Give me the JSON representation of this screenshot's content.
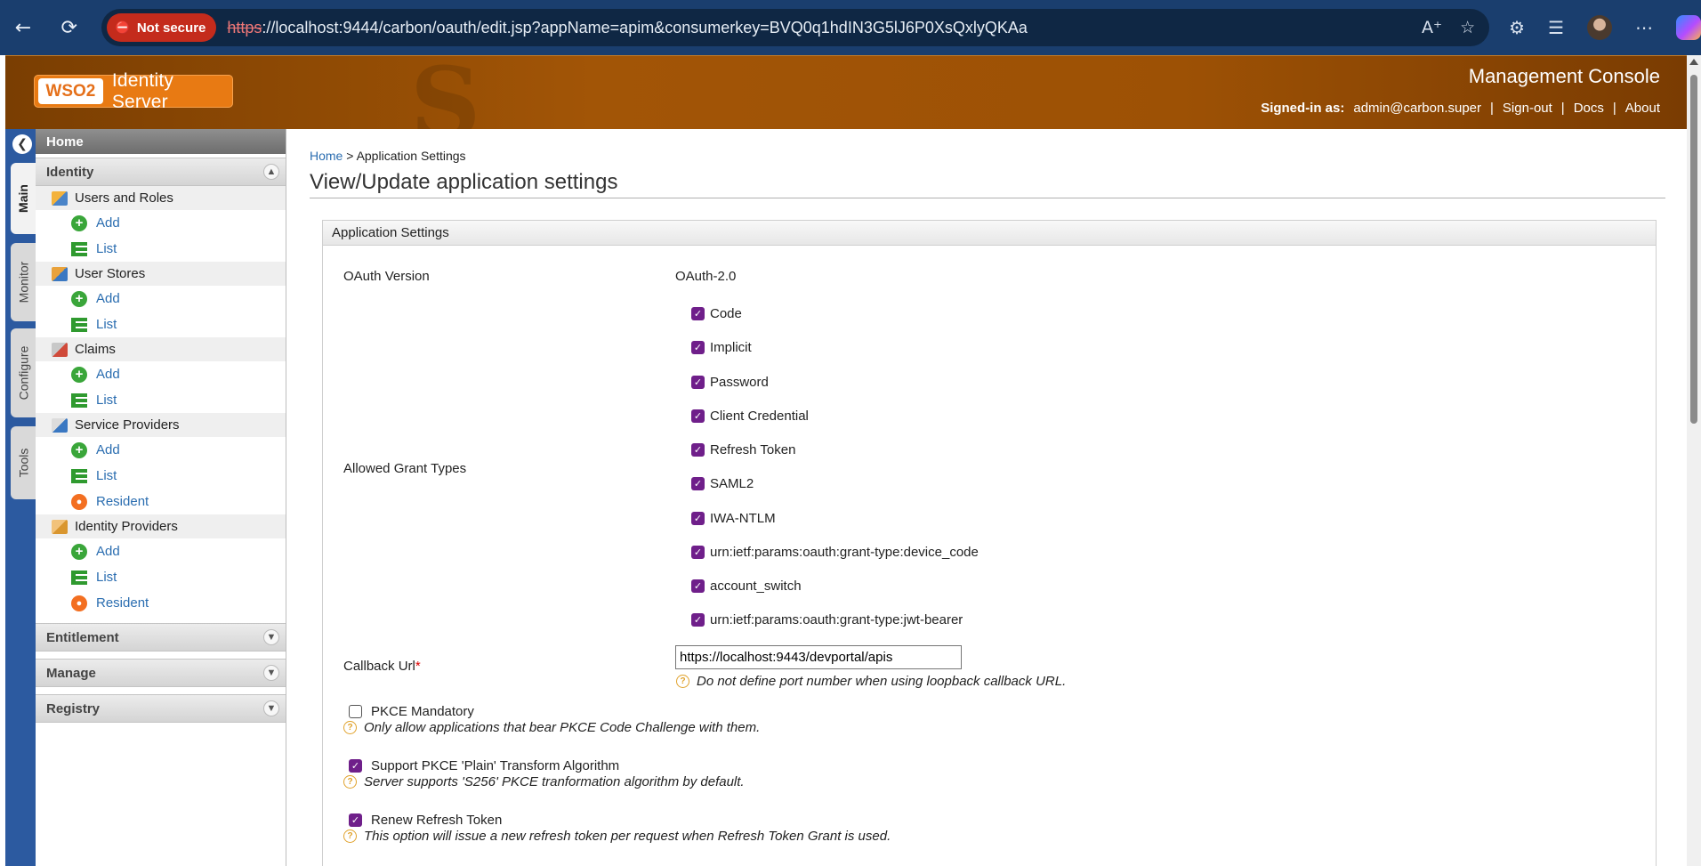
{
  "browser": {
    "not_secure": "Not secure",
    "url_proto": "https",
    "url_rest": "://localhost:9444/carbon/oauth/edit.jsp?appName=apim&consumerkey=BVQ0q1hdIN3G5lJ6P0XsQxlyQKAa",
    "icons": [
      "back-icon",
      "reload-icon",
      "read-aloud-icon",
      "favorite-icon",
      "extensions-icon",
      "favorites-list-icon",
      "profile-avatar",
      "more-icon",
      "copilot-icon"
    ]
  },
  "header": {
    "logo_brand": "WSO2",
    "logo_product": "Identity Server",
    "console_title": "Management Console",
    "signed_in_label": "Signed-in as:",
    "signed_in_user": "admin@carbon.super",
    "signout": "Sign-out",
    "docs": "Docs",
    "about": "About",
    "accent": "#a25506"
  },
  "vtabs": {
    "main": "Main",
    "monitor": "Monitor",
    "configure": "Configure",
    "tools": "Tools"
  },
  "menu": {
    "home": "Home",
    "identity": "Identity",
    "users_roles": "Users and Roles",
    "user_stores": "User Stores",
    "claims": "Claims",
    "service_providers": "Service Providers",
    "identity_providers": "Identity Providers",
    "add": "Add",
    "list": "List",
    "resident": "Resident",
    "entitlement": "Entitlement",
    "manage": "Manage",
    "registry": "Registry"
  },
  "content": {
    "breadcrumb_home": "Home",
    "breadcrumb_sep": ">",
    "breadcrumb_current": "Application Settings",
    "page_title": "View/Update application settings",
    "panel_title": "Application Settings",
    "oauth_version_label": "OAuth Version",
    "oauth_version_value": "OAuth-2.0",
    "grant_types_label": "Allowed Grant Types",
    "grant_types": [
      "Code",
      "Implicit",
      "Password",
      "Client Credential",
      "Refresh Token",
      "SAML2",
      "IWA-NTLM",
      "urn:ietf:params:oauth:grant-type:device_code",
      "account_switch",
      "urn:ietf:params:oauth:grant-type:jwt-bearer"
    ],
    "callback_label": "Callback Url",
    "callback_required": "*",
    "callback_value": "https://localhost:9443/devportal/apis",
    "callback_help": "Do not define port number when using loopback callback URL.",
    "pkce_mandatory_label": "PKCE Mandatory",
    "pkce_mandatory_help": "Only allow applications that bear PKCE Code Challenge with them.",
    "pkce_plain_label": "Support PKCE 'Plain' Transform Algorithm",
    "pkce_plain_help": "Server supports 'S256' PKCE tranformation algorithm by default.",
    "renew_refresh_label": "Renew Refresh Token",
    "renew_refresh_help": "This option will issue a new refresh token per request when Refresh Token Grant is used."
  }
}
